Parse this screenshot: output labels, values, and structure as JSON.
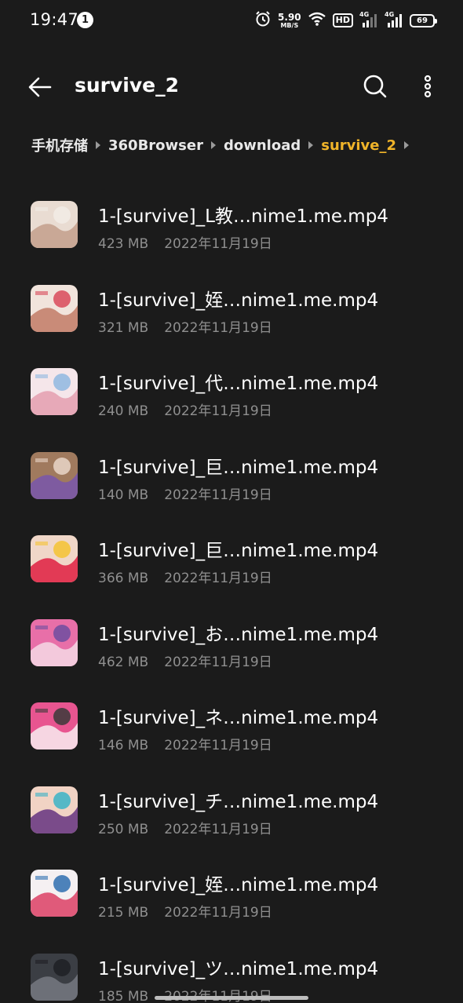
{
  "status_bar": {
    "time": "19:47",
    "notification_count": "1",
    "net_speed_value": "5.90",
    "net_speed_unit": "MB/S",
    "hd_label": "HD",
    "sim1_label": "4G",
    "sim2_label": "4G",
    "battery": "69"
  },
  "app_bar": {
    "title": "survive_2",
    "back_icon": "arrow-left-icon",
    "search_icon": "search-icon",
    "more_icon": "more-vertical-icon"
  },
  "breadcrumb": [
    {
      "label": "手机存储"
    },
    {
      "label": "360Browser"
    },
    {
      "label": "download"
    },
    {
      "label": "survive_2",
      "current": true
    }
  ],
  "files": [
    {
      "name": "1-[survive]_L教…nime1.me.mp4",
      "size": "423 MB",
      "date": "2022年11月19日",
      "thumb_colors": [
        "#e9dcd2",
        "#c9a896",
        "#f2ece6"
      ]
    },
    {
      "name": "1-[survive]_姪…nime1.me.mp4",
      "size": "321 MB",
      "date": "2022年11月19日",
      "thumb_colors": [
        "#f1e4dc",
        "#c98b78",
        "#d94a5a"
      ]
    },
    {
      "name": "1-[survive]_代…nime1.me.mp4",
      "size": "240 MB",
      "date": "2022年11月19日",
      "thumb_colors": [
        "#f5e6ea",
        "#e7a9b8",
        "#8fb7e0"
      ]
    },
    {
      "name": "1-[survive]_巨…nime1.me.mp4",
      "size": "140 MB",
      "date": "2022年11月19日",
      "thumb_colors": [
        "#a07a5e",
        "#7e5ba0",
        "#e9d6c8"
      ]
    },
    {
      "name": "1-[survive]_巨…nime1.me.mp4",
      "size": "366 MB",
      "date": "2022年11月19日",
      "thumb_colors": [
        "#f0d7c8",
        "#e23a55",
        "#f5c332"
      ]
    },
    {
      "name": "1-[survive]_お…nime1.me.mp4",
      "size": "462 MB",
      "date": "2022年11月19日",
      "thumb_colors": [
        "#e86fa8",
        "#f3c9dc",
        "#6d4ea0"
      ]
    },
    {
      "name": "1-[survive]_ネ…nime1.me.mp4",
      "size": "146 MB",
      "date": "2022年11月19日",
      "thumb_colors": [
        "#e85590",
        "#f6d6e2",
        "#3a3a3a"
      ]
    },
    {
      "name": "1-[survive]_チ…nime1.me.mp4",
      "size": "250 MB",
      "date": "2022年11月19日",
      "thumb_colors": [
        "#f1d3c4",
        "#7a4b8a",
        "#3bb3c7"
      ]
    },
    {
      "name": "1-[survive]_姪…nime1.me.mp4",
      "size": "215 MB",
      "date": "2022年11月19日",
      "thumb_colors": [
        "#f5f0f2",
        "#e05a7a",
        "#2f6fb0"
      ]
    },
    {
      "name": "1-[survive]_ツ…nime1.me.mp4",
      "size": "185 MB",
      "date": "2022年11月19日",
      "thumb_colors": [
        "#3b3e44",
        "#6d7078",
        "#1f2024"
      ]
    }
  ]
}
